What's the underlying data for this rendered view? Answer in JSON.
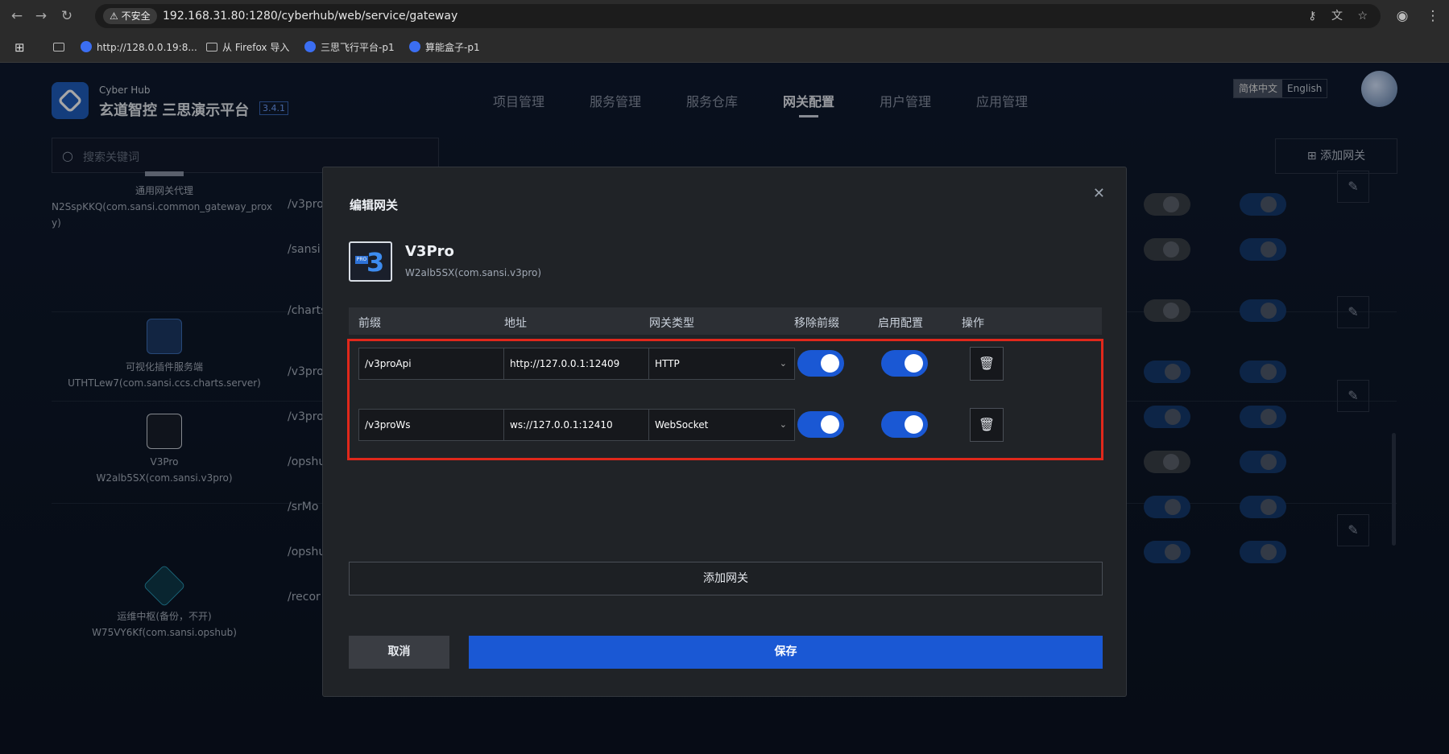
{
  "browser": {
    "security_label": "不安全",
    "url": "192.168.31.80:1280/cyberhub/web/service/gateway",
    "bookmarks": [
      "http://128.0.0.19:8...",
      "从 Firefox 导入",
      "三思飞行平台-p1",
      "算能盒子-p1"
    ]
  },
  "app": {
    "brand_sub": "Cyber Hub",
    "brand_main": "玄道智控 三思演示平台",
    "version": "3.4.1",
    "nav": [
      "项目管理",
      "服务管理",
      "服务仓库",
      "网关配置",
      "用户管理",
      "应用管理"
    ],
    "nav_active": "网关配置",
    "lang": [
      "简体中文",
      "English"
    ],
    "search_placeholder": "搜索关键词",
    "add_gateway": "添加网关"
  },
  "background": {
    "services": [
      {
        "name": "通用网关代理",
        "id": "N2SspKKQ(com.sansi.common_gateway_prox",
        "id_cont": "y)"
      },
      {
        "name": "可视化插件服务端",
        "id": "UTHTLew7(com.sansi.ccs.charts.server)"
      },
      {
        "name": "V3Pro",
        "id": "W2alb5SX(com.sansi.v3pro)"
      },
      {
        "name": "运维中枢(备份，不开)",
        "id": "W75VY6Kf(com.sansi.opshub)"
      }
    ],
    "prefixes": [
      "/v3pro",
      "/sansi",
      "/charts",
      "/v3pro",
      "/v3pro",
      "/opshu",
      "/srMo",
      "/opshu",
      "/recor"
    ]
  },
  "modal": {
    "title": "编辑网关",
    "service_name": "V3Pro",
    "service_id": "W2alb5SX(com.sansi.v3pro)",
    "logo_badge": "PRO",
    "logo_digit": "3",
    "headers": [
      "前缀",
      "地址",
      "网关类型",
      "移除前缀",
      "启用配置",
      "操作"
    ],
    "rows": [
      {
        "prefix": "/v3proApi",
        "address": "http://127.0.0.1:12409",
        "type": "HTTP",
        "strip_prefix": true,
        "enabled": true
      },
      {
        "prefix": "/v3proWs",
        "address": "ws://127.0.0.1:12410",
        "type": "WebSocket",
        "strip_prefix": true,
        "enabled": true
      }
    ],
    "add_button": "添加网关",
    "cancel": "取消",
    "save": "保存"
  },
  "colors": {
    "accent": "#1a58d4",
    "highlight": "#e0281b"
  }
}
